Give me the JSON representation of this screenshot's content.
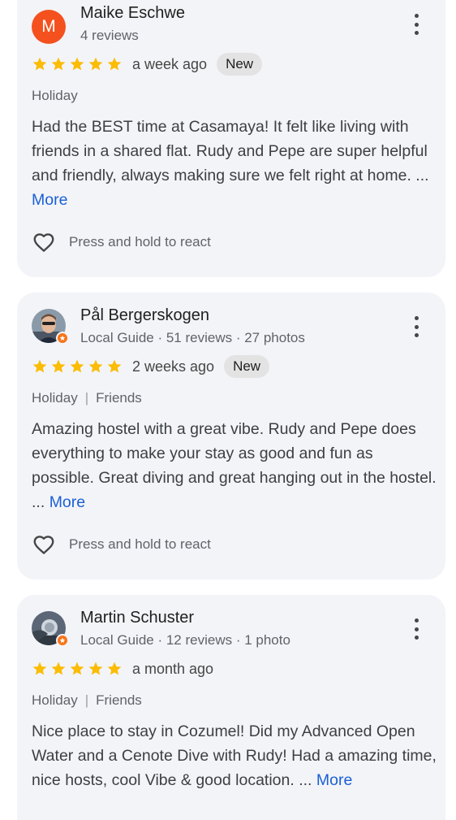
{
  "reviews": [
    {
      "reviewer": "Maike Eschwe",
      "avatar_letter": "M",
      "meta": "4 reviews",
      "time": "a week ago",
      "badge": "New",
      "tags": [
        "Holiday"
      ],
      "text": "Had the BEST time at Casamaya! It felt like living with friends in a shared flat. Rudy and Pepe are super helpful and friendly, always making sure we felt right at home.",
      "ellipsis": "...",
      "more": "More",
      "react": "Press and hold to react",
      "rating": 5
    },
    {
      "reviewer": "Pål Bergerskogen",
      "meta": "Local Guide · 51 reviews · 27 photos",
      "time": "2 weeks ago",
      "badge": "New",
      "tags": [
        "Holiday",
        "Friends"
      ],
      "text": "Amazing hostel with a great vibe. Rudy and Pepe does everything to make your stay as good and fun as possible. Great diving and great hanging out in the hostel.",
      "ellipsis": "...",
      "more": "More",
      "react": "Press and hold to react",
      "rating": 5
    },
    {
      "reviewer": "Martin Schuster",
      "meta": "Local Guide · 12 reviews · 1 photo",
      "time": "a month ago",
      "tags": [
        "Holiday",
        "Friends"
      ],
      "text": "Nice place to stay in Cozumel! Did my Advanced Open Water and a Cenote Dive with Rudy! Had a amazing time, nice hosts, cool Vibe & good location.",
      "ellipsis": "...",
      "more": "More",
      "rating": 5
    }
  ],
  "colors": {
    "star": "#fbbc04",
    "link": "#1a5fd6",
    "avatar_bg": "#f4511e",
    "guide_badge": "#f97316",
    "card_bg": "#f3f4f8"
  },
  "icons": {
    "star": "star-icon",
    "menu": "more-vert-icon",
    "react": "heart-outline-icon",
    "guide": "local-guide-badge-icon"
  }
}
